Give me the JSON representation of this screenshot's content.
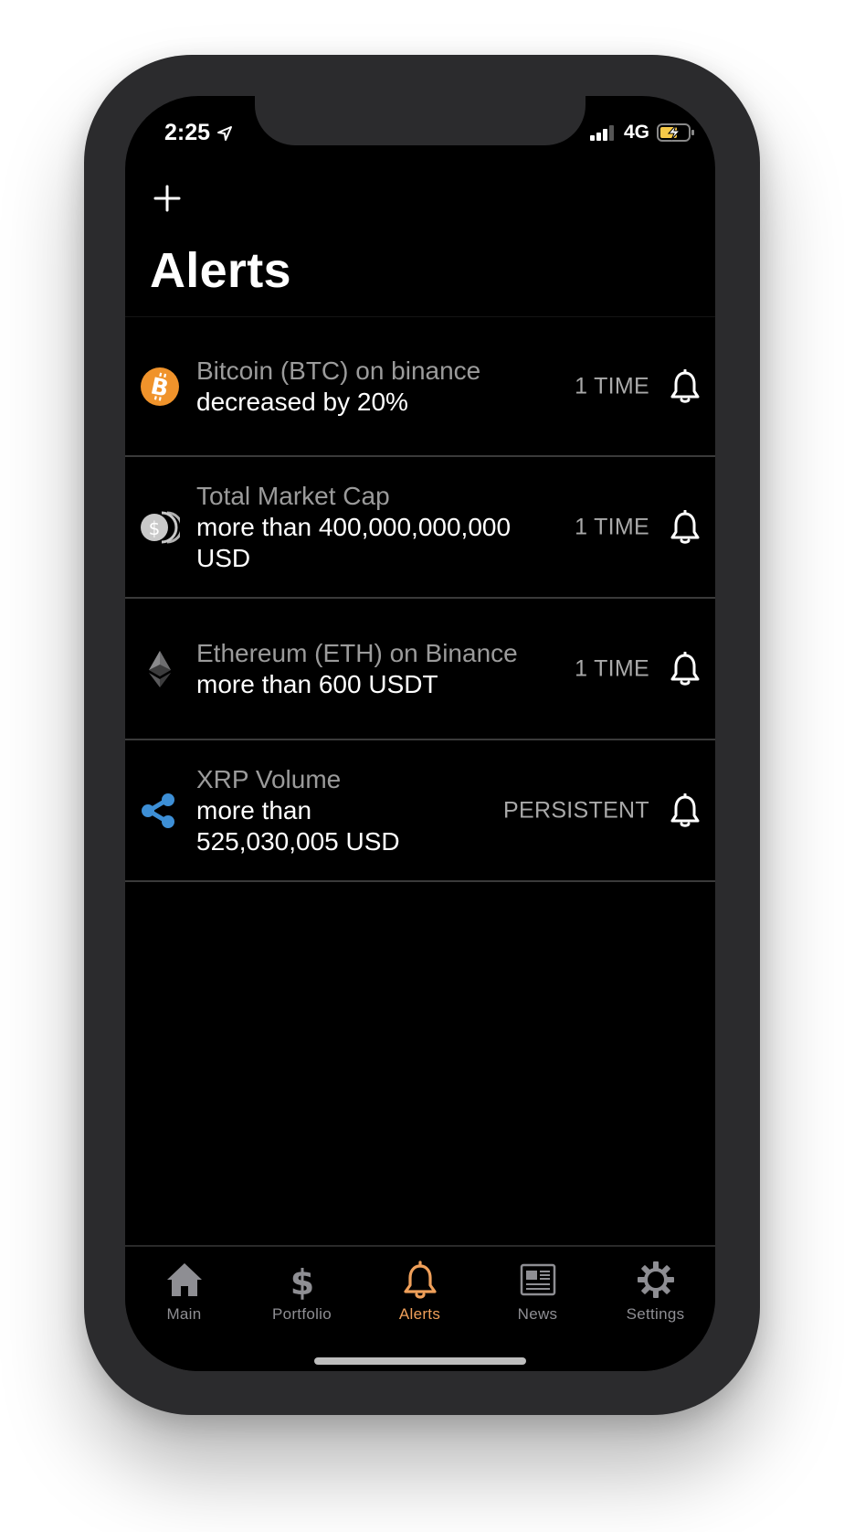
{
  "status_bar": {
    "time": "2:25",
    "network": "4G"
  },
  "header": {
    "add_icon": "plus-icon",
    "title": "Alerts"
  },
  "alerts": [
    {
      "icon": "bitcoin-icon",
      "name": "Bitcoin (BTC) on binance",
      "condition": "decreased by 20%",
      "frequency": "1 TIME"
    },
    {
      "icon": "market-cap-coins-icon",
      "name": "Total Market Cap",
      "condition": "more than 400,000,000,000 USD",
      "frequency": "1 TIME"
    },
    {
      "icon": "ethereum-icon",
      "name": "Ethereum (ETH) on Binance",
      "condition": "more than 600 USDT",
      "frequency": "1 TIME"
    },
    {
      "icon": "xrp-icon",
      "name": "XRP Volume",
      "condition": "more than 525,030,005 USD",
      "frequency": "PERSISTENT"
    }
  ],
  "tab_bar": {
    "active": "Alerts",
    "tabs": [
      {
        "label": "Main",
        "icon": "home-icon"
      },
      {
        "label": "Portfolio",
        "icon": "dollar-icon"
      },
      {
        "label": "Alerts",
        "icon": "bell-icon"
      },
      {
        "label": "News",
        "icon": "newspaper-icon"
      },
      {
        "label": "Settings",
        "icon": "gear-icon"
      }
    ]
  },
  "colors": {
    "accent": "#f0a05a",
    "bitcoin": "#f7931a",
    "xrp": "#3d8fd6"
  }
}
